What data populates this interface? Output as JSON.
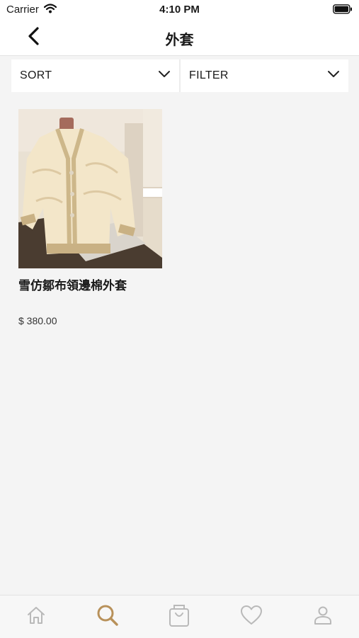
{
  "status": {
    "carrier": "Carrier",
    "time": "4:10 PM"
  },
  "header": {
    "title": "外套"
  },
  "filters": {
    "sort_label": "SORT",
    "filter_label": "FILTER"
  },
  "products": [
    {
      "name": "雪仿鄒布領邊棉外套",
      "price": "$ 380.00"
    }
  ],
  "tabs": [
    "home-icon",
    "search-icon",
    "bag-icon",
    "heart-icon",
    "profile-icon"
  ],
  "colors": {
    "accent": "#b8915a",
    "icon_inactive": "#b9b9b9"
  }
}
